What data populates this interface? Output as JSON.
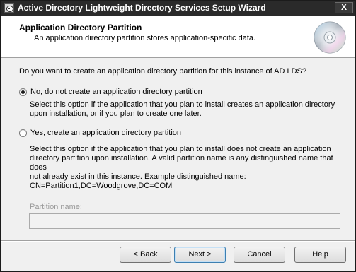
{
  "window": {
    "title": "Active Directory Lightweight Directory Services Setup Wizard",
    "close_label": "X"
  },
  "header": {
    "title": "Application Directory Partition",
    "subtitle": "An application directory partition stores application-specific data."
  },
  "question": "Do you want to create an application directory partition for this instance of AD LDS?",
  "options": [
    {
      "label": "No, do not create an application directory partition",
      "selected": true,
      "description": [
        "Select this option if the application that you plan to install creates an application directory",
        "upon installation, or if you plan to create one later."
      ]
    },
    {
      "label": "Yes, create an application directory partition",
      "selected": false,
      "description": [
        "Select this option if the application that you plan to install does not create an application",
        "directory partition upon installation. A valid partition name is any distinguished name that does",
        "not already exist in this instance. Example distinguished name:",
        "CN=Partition1,DC=Woodgrove,DC=COM"
      ]
    }
  ],
  "partition": {
    "label": "Partition name:",
    "value": ""
  },
  "buttons": {
    "back": "< Back",
    "next": "Next >",
    "cancel": "Cancel",
    "help": "Help"
  },
  "icons": {
    "title": "app-window-icon",
    "header": "cd-disc-icon"
  }
}
